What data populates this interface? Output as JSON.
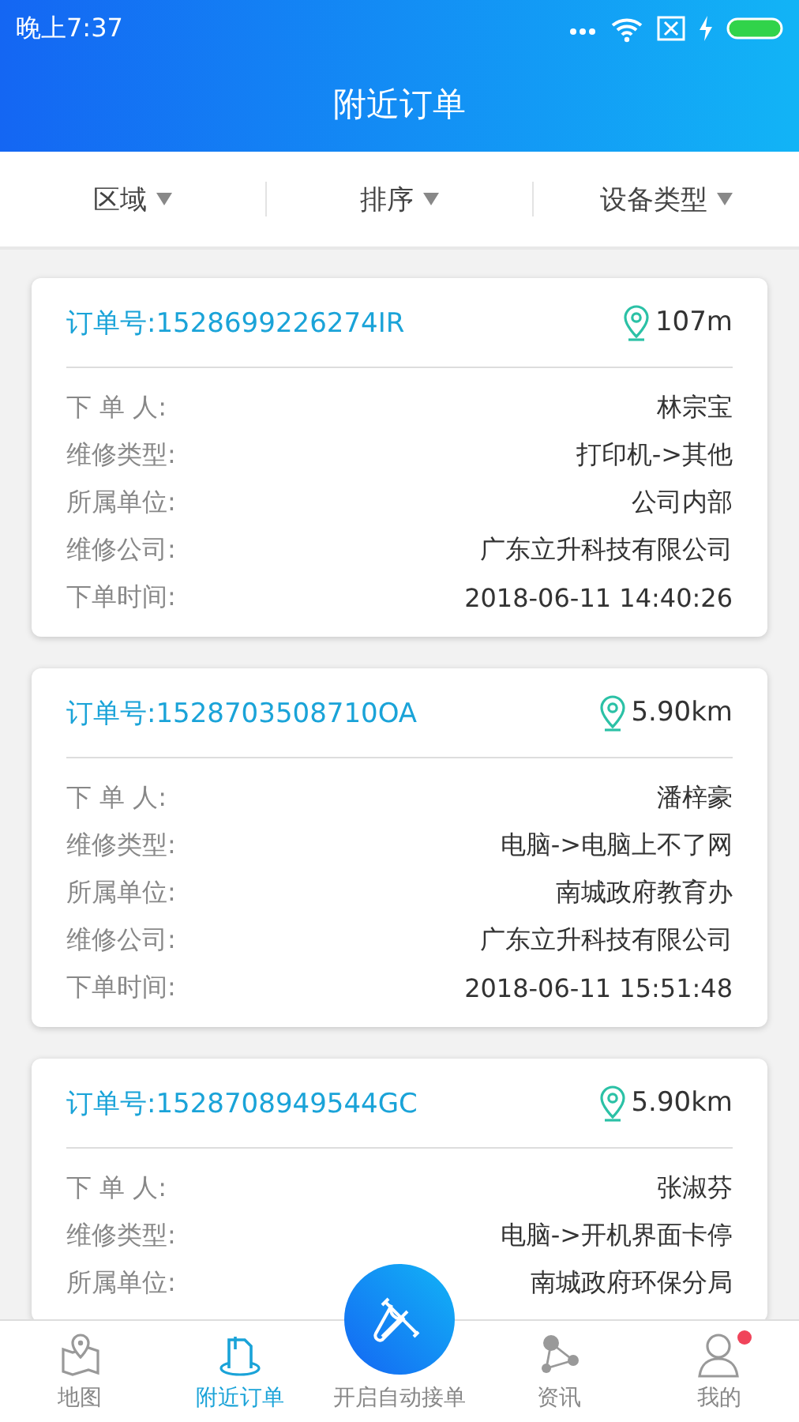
{
  "status_bar": {
    "time": "晚上7:37"
  },
  "header": {
    "title": "附近订单"
  },
  "filters": [
    {
      "label": "区域"
    },
    {
      "label": "排序"
    },
    {
      "label": "设备类型"
    }
  ],
  "orders": [
    {
      "order_no": "订单号:1528699226274IR",
      "distance": "107m",
      "fields": [
        {
          "label": "下 单 人:",
          "value": "林宗宝"
        },
        {
          "label": "维修类型:",
          "value": "打印机->其他"
        },
        {
          "label": "所属单位:",
          "value": "公司内部"
        },
        {
          "label": "维修公司:",
          "value": "广东立升科技有限公司"
        },
        {
          "label": "下单时间:",
          "value": "2018-06-11 14:40:26"
        }
      ]
    },
    {
      "order_no": "订单号:1528703508710OA",
      "distance": "5.90km",
      "fields": [
        {
          "label": "下 单 人:",
          "value": "潘梓豪"
        },
        {
          "label": "维修类型:",
          "value": "电脑->电脑上不了网"
        },
        {
          "label": "所属单位:",
          "value": "南城政府教育办"
        },
        {
          "label": "维修公司:",
          "value": "广东立升科技有限公司"
        },
        {
          "label": "下单时间:",
          "value": "2018-06-11 15:51:48"
        }
      ]
    },
    {
      "order_no": "订单号:1528708949544GC",
      "distance": "5.90km",
      "fields": [
        {
          "label": "下 单 人:",
          "value": "张淑芬"
        },
        {
          "label": "维修类型:",
          "value": "电脑->开机界面卡停"
        },
        {
          "label": "所属单位:",
          "value": "南城政府环保分局"
        }
      ]
    }
  ],
  "bottom_nav": [
    {
      "kind": "map",
      "label": "地图",
      "selected": false,
      "dot": false
    },
    {
      "kind": "orders",
      "label": "附近订单",
      "selected": true,
      "dot": false
    },
    {
      "kind": "auto",
      "label": "开启自动接单",
      "selected": false,
      "dot": false
    },
    {
      "kind": "news",
      "label": "资讯",
      "selected": false,
      "dot": false
    },
    {
      "kind": "me",
      "label": "我的",
      "selected": false,
      "dot": true
    }
  ]
}
